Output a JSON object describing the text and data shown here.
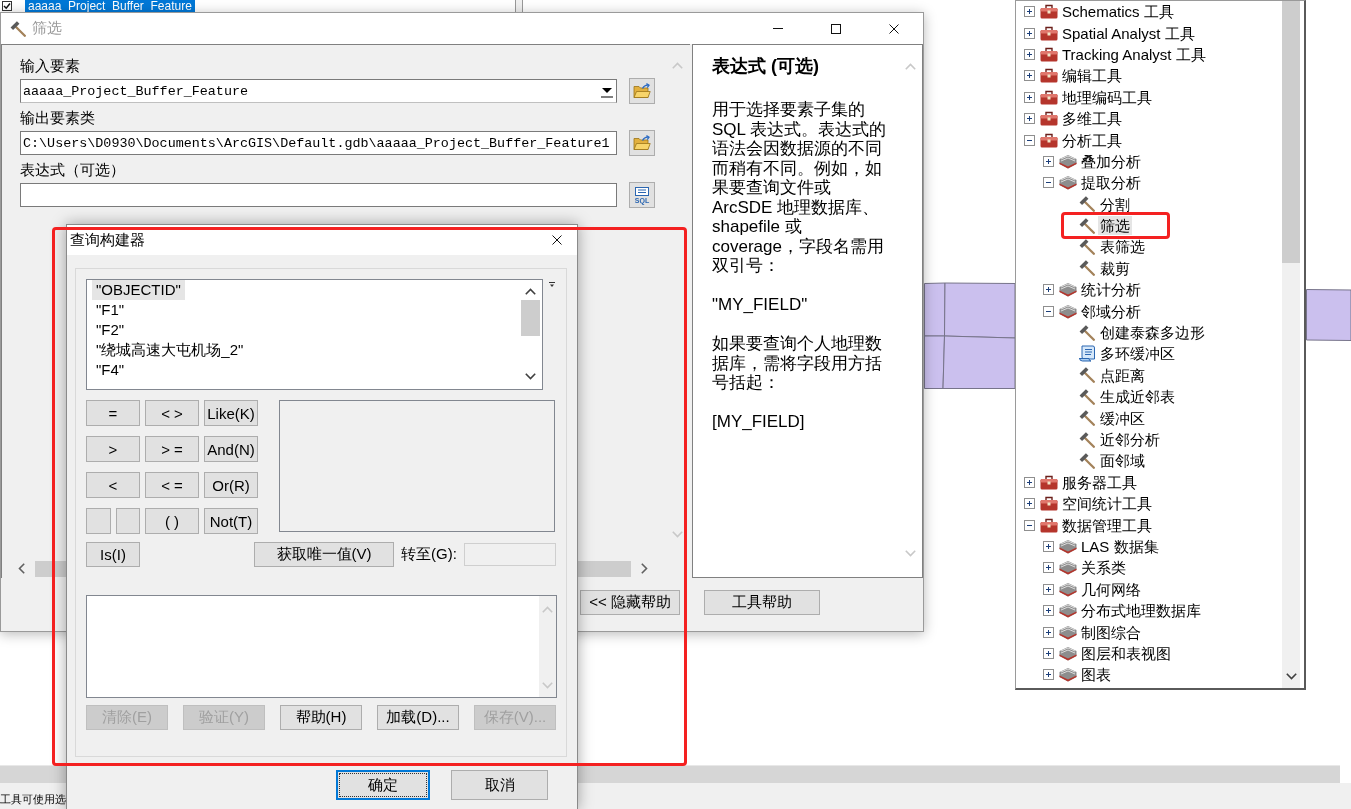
{
  "layers_panel": {
    "layers": [
      {
        "label": "aaaaa_Project_Buffer_Feature",
        "checked": true,
        "selected": true
      }
    ]
  },
  "tool_dialog": {
    "title": "筛选",
    "parameters": [
      {
        "kind": "dropdown",
        "label": "输入要素",
        "value": "aaaaa_Project_Buffer_Feature"
      },
      {
        "kind": "path",
        "label": "输出要素类",
        "value": "C:\\Users\\D0930\\Documents\\ArcGIS\\Default.gdb\\aaaaa_Project_Buffer_Feature1"
      },
      {
        "kind": "sql",
        "label": "表达式（可选）",
        "button_text": "SQL"
      }
    ],
    "help": {
      "title": "表达式 (可选)",
      "paragraphs": [
        "用于选择要素子集的 SQL 表达式。表达式的语法会因数据源的不同而稍有不同。例如，如果要查询文件或 ArcSDE 地理数据库、shapefile 或 coverage，字段名需用双引号：",
        "\"MY_FIELD\"",
        "如果要查询个人地理数据库，需将字段用方括号括起：",
        "[MY_FIELD]"
      ]
    },
    "buttons": [
      "<< 隐藏帮助",
      "工具帮助"
    ]
  },
  "query_builder": {
    "title": "查询构建器",
    "annotated": true,
    "fields": [
      {
        "label": "\"OBJECTID\"",
        "selected": true
      },
      {
        "label": "\"F1\"",
        "selected": false
      },
      {
        "label": "\"F2\"",
        "selected": false
      },
      {
        "label": "\"绕城高速大屯机场_2\"",
        "selected": false
      },
      {
        "label": "\"F4\"",
        "selected": false
      }
    ],
    "operator_rows": [
      [
        {
          "kind": "full",
          "label": "="
        },
        {
          "kind": "full",
          "label": "< >"
        },
        {
          "kind": "full",
          "label": "Like(K)"
        }
      ],
      [
        {
          "kind": "full",
          "label": ">"
        },
        {
          "kind": "full",
          "label": "> ="
        },
        {
          "kind": "full",
          "label": "And(N)"
        }
      ],
      [
        {
          "kind": "full",
          "label": "<"
        },
        {
          "kind": "full",
          "label": "< ="
        },
        {
          "kind": "full",
          "label": "Or(R)"
        }
      ],
      [
        {
          "kind": "half"
        },
        {
          "kind": "half"
        },
        {
          "kind": "full",
          "label": "( )"
        },
        {
          "kind": "full",
          "label": "Not(T)"
        }
      ]
    ],
    "is_button": "Is(I)",
    "unique_values_button": "获取唯一值(V)",
    "go_to_label": "转至(G):",
    "actions": [
      {
        "label": "清除(E)",
        "disabled": true
      },
      {
        "label": "验证(Y)",
        "disabled": true
      },
      {
        "label": "帮助(H)",
        "disabled": false
      },
      {
        "label": "加载(D)...",
        "disabled": false
      },
      {
        "label": "保存(V)...",
        "disabled": true
      }
    ],
    "dialog_buttons": [
      {
        "label": "确定",
        "focused": true
      },
      {
        "label": "取消",
        "focused": false
      }
    ]
  },
  "toolbox": {
    "items": [
      {
        "kind": "toolbox",
        "label": "Schematics 工具",
        "expanded": false,
        "selected": false,
        "annotated": false
      },
      {
        "kind": "toolbox",
        "label": "Spatial Analyst 工具",
        "expanded": false,
        "selected": false,
        "annotated": false
      },
      {
        "kind": "toolbox",
        "label": "Tracking Analyst 工具",
        "expanded": false,
        "selected": false,
        "annotated": false
      },
      {
        "kind": "toolbox",
        "label": "编辑工具",
        "expanded": false,
        "selected": false,
        "annotated": false
      },
      {
        "kind": "toolbox",
        "label": "地理编码工具",
        "expanded": false,
        "selected": false,
        "annotated": false
      },
      {
        "kind": "toolbox",
        "label": "多维工具",
        "expanded": false,
        "selected": false,
        "annotated": false
      },
      {
        "kind": "toolbox",
        "label": "分析工具",
        "expanded": true,
        "selected": false,
        "annotated": false,
        "children": [
          {
            "kind": "toolset",
            "label": "叠加分析",
            "expanded": false,
            "selected": false,
            "annotated": false
          },
          {
            "kind": "toolset",
            "label": "提取分析",
            "expanded": true,
            "selected": false,
            "annotated": false,
            "children": [
              {
                "kind": "tool",
                "label": "分割",
                "selected": false,
                "annotated": false
              },
              {
                "kind": "tool",
                "label": "筛选",
                "selected": true,
                "annotated": true
              },
              {
                "kind": "tool",
                "label": "表筛选",
                "selected": false,
                "annotated": false
              },
              {
                "kind": "tool",
                "label": "裁剪",
                "selected": false,
                "annotated": false
              }
            ]
          },
          {
            "kind": "toolset",
            "label": "统计分析",
            "expanded": false,
            "selected": false,
            "annotated": false
          },
          {
            "kind": "toolset",
            "label": "邻域分析",
            "expanded": true,
            "selected": false,
            "annotated": false,
            "children": [
              {
                "kind": "tool",
                "label": "创建泰森多边形",
                "selected": false,
                "annotated": false
              },
              {
                "kind": "script",
                "label": "多环缓冲区",
                "selected": false,
                "annotated": false
              },
              {
                "kind": "tool",
                "label": "点距离",
                "selected": false,
                "annotated": false
              },
              {
                "kind": "tool",
                "label": "生成近邻表",
                "selected": false,
                "annotated": false
              },
              {
                "kind": "tool",
                "label": "缓冲区",
                "selected": false,
                "annotated": false
              },
              {
                "kind": "tool",
                "label": "近邻分析",
                "selected": false,
                "annotated": false
              },
              {
                "kind": "tool",
                "label": "面邻域",
                "selected": false,
                "annotated": false
              }
            ]
          }
        ]
      },
      {
        "kind": "toolbox",
        "label": "服务器工具",
        "expanded": false,
        "selected": false,
        "annotated": false
      },
      {
        "kind": "toolbox",
        "label": "空间统计工具",
        "expanded": false,
        "selected": false,
        "annotated": false
      },
      {
        "kind": "toolbox",
        "label": "数据管理工具",
        "expanded": true,
        "selected": false,
        "annotated": false,
        "children": [
          {
            "kind": "toolset",
            "label": "LAS 数据集",
            "expanded": false,
            "selected": false,
            "annotated": false
          },
          {
            "kind": "toolset",
            "label": "关系类",
            "expanded": false,
            "selected": false,
            "annotated": false
          },
          {
            "kind": "toolset",
            "label": "几何网络",
            "expanded": false,
            "selected": false,
            "annotated": false
          },
          {
            "kind": "toolset",
            "label": "分布式地理数据库",
            "expanded": false,
            "selected": false,
            "annotated": false
          },
          {
            "kind": "toolset",
            "label": "制图综合",
            "expanded": false,
            "selected": false,
            "annotated": false
          },
          {
            "kind": "toolset",
            "label": "图层和表视图",
            "expanded": false,
            "selected": false,
            "annotated": false
          },
          {
            "kind": "toolset",
            "label": "图表",
            "expanded": false,
            "selected": false,
            "annotated": false
          }
        ]
      }
    ]
  },
  "status_bar": {
    "text": "工具可使用选"
  }
}
